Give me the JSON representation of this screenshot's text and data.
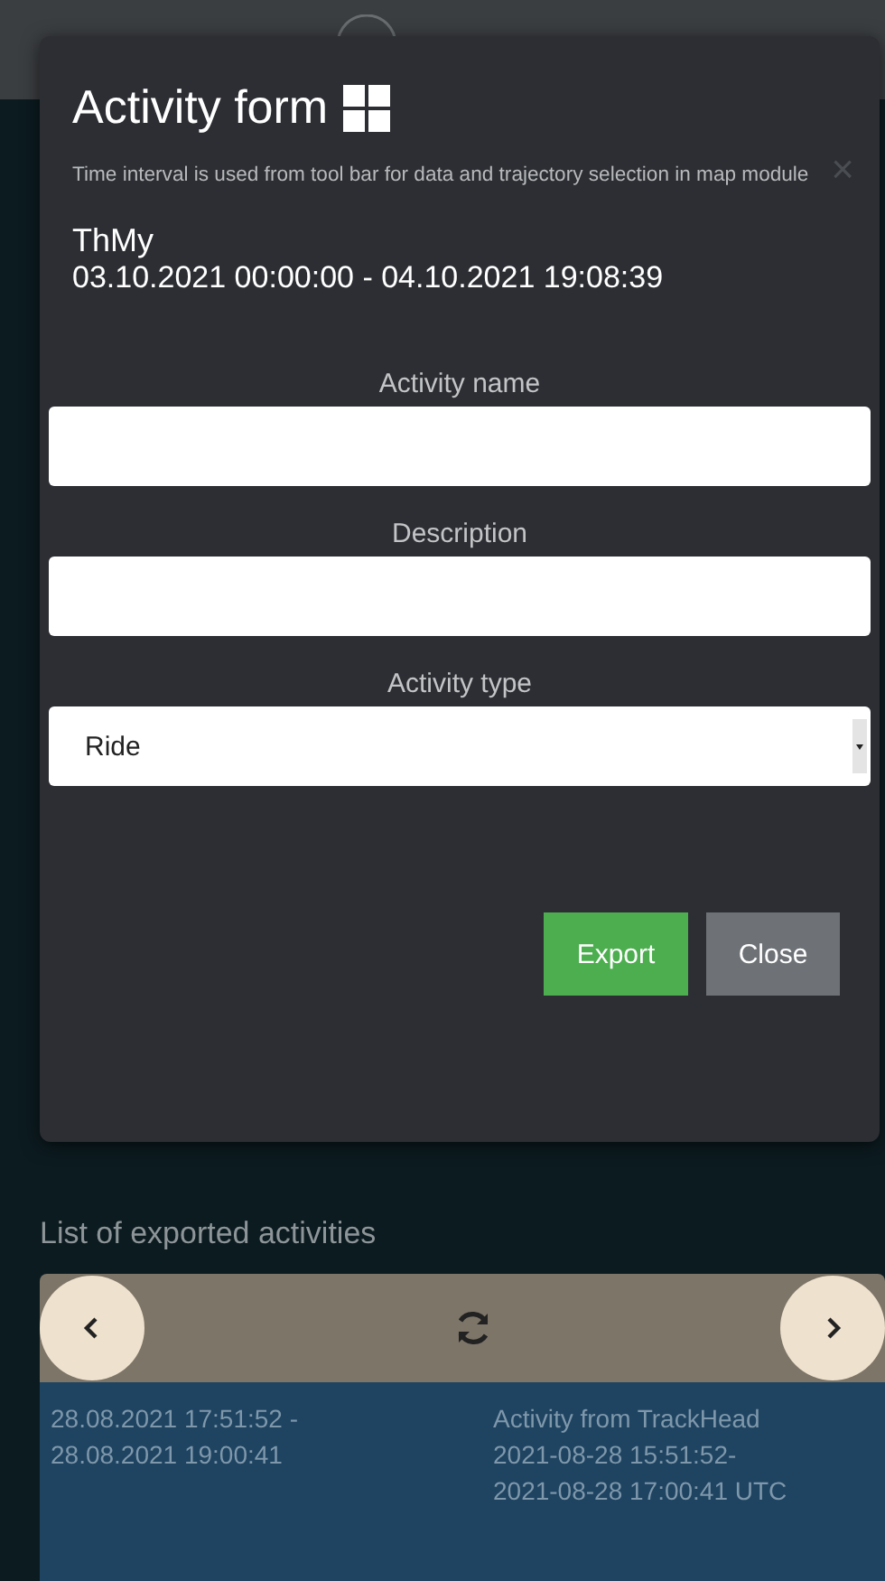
{
  "modal": {
    "title": "Activity form",
    "note": "Time interval is used from tool bar for data and trajectory selection in map module",
    "close": "×",
    "user": "ThMy",
    "interval": "03.10.2021 00:00:00 - 04.10.2021 19:08:39",
    "fields": [
      {
        "kind": "text",
        "label": "Activity name"
      },
      {
        "kind": "text",
        "label": "Description"
      },
      {
        "kind": "select",
        "label": "Activity type",
        "value": "Ride"
      }
    ],
    "buttons": [
      {
        "kind": "primary",
        "label": "Export"
      },
      {
        "kind": "secondary",
        "label": "Close"
      }
    ]
  },
  "exported": {
    "title": "List of exported activities",
    "rows": [
      {
        "interval": "28.08.2021 17:51:52 - 28.08.2021 19:00:41",
        "description": "Activity from TrackHead 2021-08-28 15:51:52-2021-08-28 17:00:41 UTC"
      }
    ]
  }
}
